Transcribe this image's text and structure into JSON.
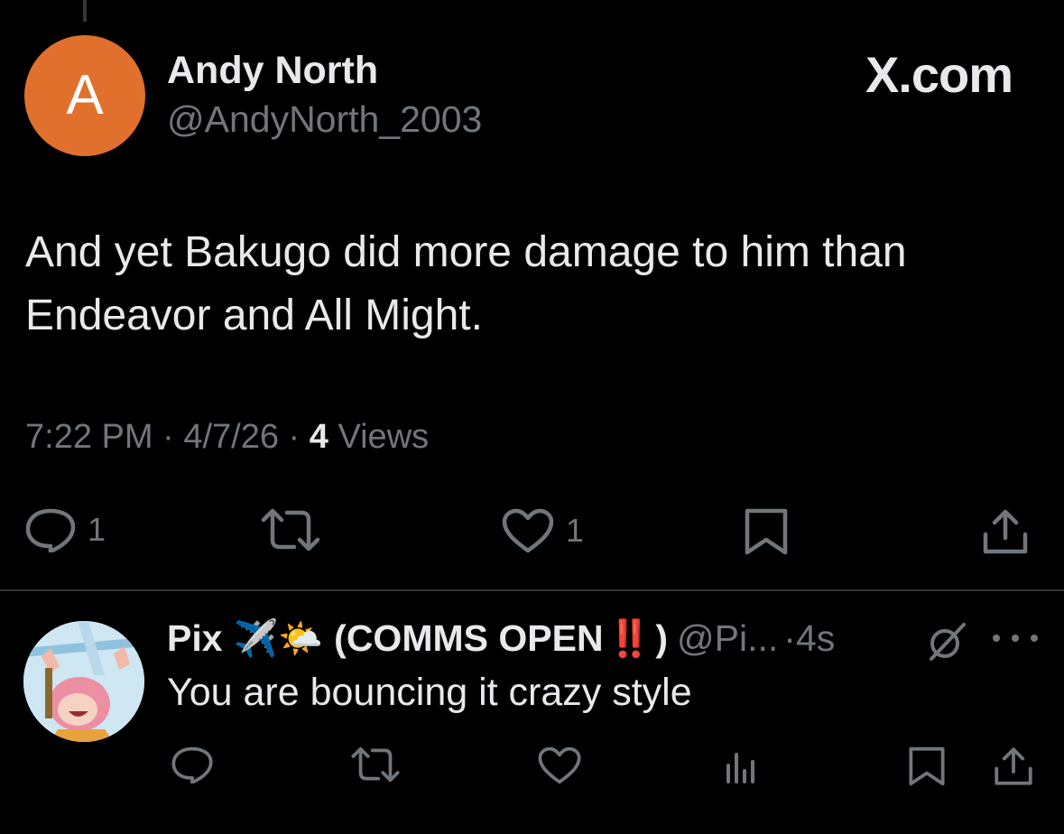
{
  "tweet": {
    "avatar_letter": "A",
    "author_name": "Andy North",
    "author_handle": "@AndyNorth_2003",
    "brand": "X.com",
    "text": "And yet Bakugo did more damage to him than Endeavor and All Might.",
    "time": "7:22 PM",
    "date": "4/7/26",
    "views_count": "4",
    "views_label": "Views",
    "separator": "·",
    "reply_count": "1",
    "like_count": "1"
  },
  "reply": {
    "name": "Pix",
    "name_suffix": "(COMMS OPEN",
    "name_close": ")",
    "emoji_plane": "✈️",
    "emoji_cloud": "🌤️",
    "emoji_bang": "‼️",
    "handle": "@Pi...",
    "separator": "·",
    "time": "4s",
    "text": "You are bouncing it crazy style"
  },
  "colors": {
    "background": "#000000",
    "text_primary": "#e7e9ea",
    "text_secondary": "#71767b",
    "avatar_bg": "#e0702c",
    "divider": "#2f3336",
    "emoji_red": "#e0242f"
  },
  "icons": {
    "reply": "speech-bubble-icon",
    "repost": "repost-arrows-icon",
    "like": "heart-icon",
    "bookmark": "bookmark-icon",
    "share": "share-upload-icon",
    "views": "bar-chart-icon",
    "grok": "slashed-circle-icon",
    "more": "ellipsis-icon"
  }
}
